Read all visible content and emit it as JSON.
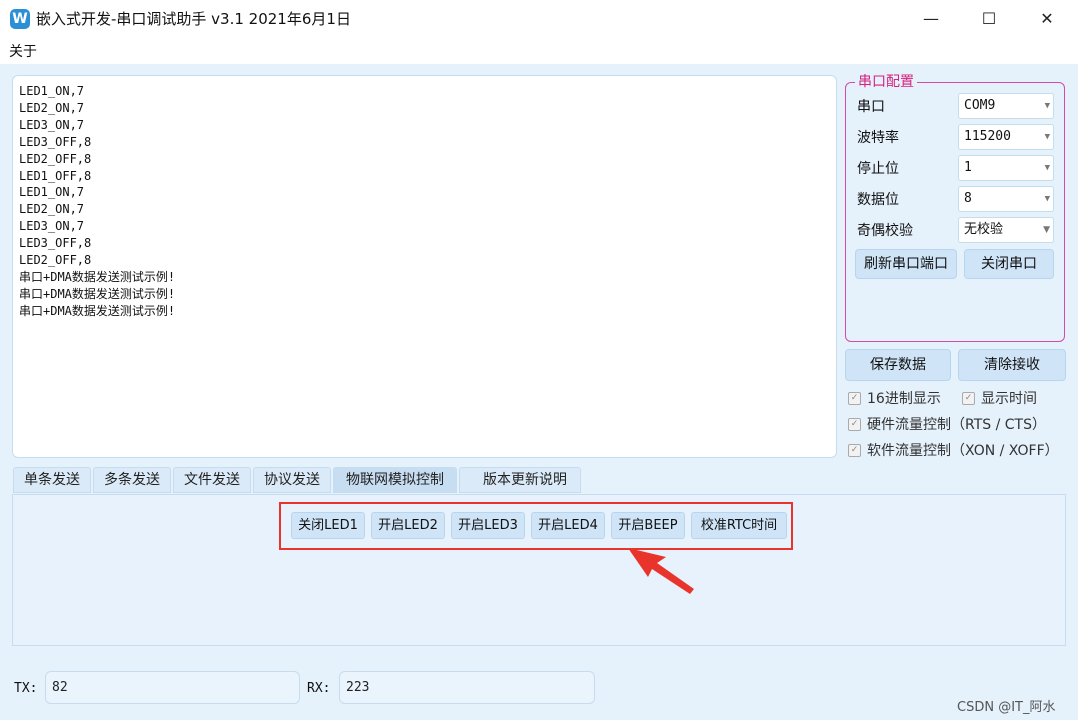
{
  "window": {
    "icon_letter": "W",
    "title": "嵌入式开发-串口调试助手 v3.1 2021年6月1日",
    "minimize": "—",
    "maximize": "☐",
    "close": "✕"
  },
  "menu": {
    "about": "关于"
  },
  "receive_lines": [
    "LED1_ON,7",
    "LED2_ON,7",
    "LED3_ON,7",
    "LED3_OFF,8",
    "LED2_OFF,8",
    "LED1_OFF,8",
    "LED1_ON,7",
    "LED2_ON,7",
    "LED3_ON,7",
    "LED3_OFF,8",
    "LED2_OFF,8",
    "串口+DMA数据发送测试示例!",
    "串口+DMA数据发送测试示例!",
    "串口+DMA数据发送测试示例!"
  ],
  "serial_config": {
    "title": "串口配置",
    "port_label": "串口",
    "port_value": "COM9",
    "baud_label": "波特率",
    "baud_value": "115200",
    "stop_label": "停止位",
    "stop_value": "1",
    "data_label": "数据位",
    "data_value": "8",
    "parity_label": "奇偶校验",
    "parity_value": "无校验",
    "refresh_button": "刷新串口端口",
    "close_button": "关闭串口"
  },
  "actions": {
    "save_button": "保存数据",
    "clear_button": "清除接收"
  },
  "options": {
    "hex_display": "16进制显示",
    "show_time": "显示时间",
    "hw_flow": "硬件流量控制（RTS / CTS）",
    "sw_flow": "软件流量控制（XON / XOFF）"
  },
  "tabs": [
    "单条发送",
    "多条发送",
    "文件发送",
    "协议发送",
    "物联网模拟控制",
    "版本更新说明"
  ],
  "iot_controls": [
    "关闭LED1",
    "开启LED2",
    "开启LED3",
    "开启LED4",
    "开启BEEP",
    "校准RTC时间"
  ],
  "tx": {
    "label": "TX:",
    "value": "82"
  },
  "rx": {
    "label": "RX:",
    "value": "223"
  },
  "watermark": "CSDN @IT_阿水",
  "colors": {
    "group_border": "#d34aa8",
    "highlight_box": "#e8342a",
    "arrow": "#e8342a"
  },
  "annotation_icon": "red-arrow-icon"
}
